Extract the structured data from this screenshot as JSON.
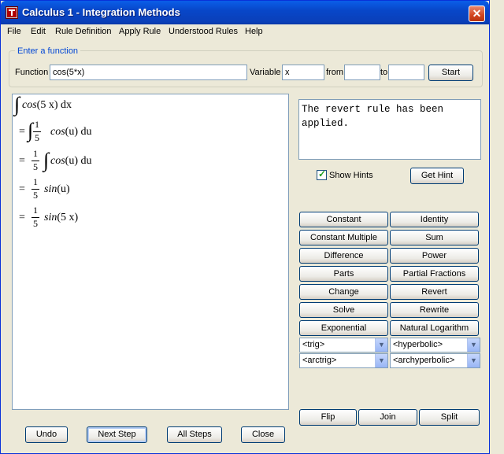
{
  "window": {
    "title": "Calculus 1 - Integration Methods",
    "close_glyph": "✕"
  },
  "menu": {
    "items": [
      "File",
      "Edit",
      "Rule Definition",
      "Apply Rule",
      "Understood Rules",
      "Help"
    ]
  },
  "entry": {
    "legend": "Enter a function",
    "function_label": "Function",
    "function_value": "cos(5*x)",
    "variable_label": "Variable",
    "variable_value": "x",
    "from_label": "from",
    "from_value": "",
    "to_label": "to",
    "to_value": "",
    "start_label": "Start"
  },
  "steps": {
    "line1": {
      "func": "cos",
      "arg": "(5 x)",
      "d": "dx"
    },
    "line2": {
      "eq": "=",
      "num": "1",
      "den": "5",
      "func": "cos",
      "arg": "(u)",
      "d": "du"
    },
    "line3": {
      "eq": "=",
      "num": "1",
      "den": "5",
      "func": "cos",
      "arg": "(u)",
      "d": "du"
    },
    "line4": {
      "eq": "=",
      "num": "1",
      "den": "5",
      "func": "sin",
      "arg": "(u)"
    },
    "line5": {
      "eq": "=",
      "num": "1",
      "den": "5",
      "func": "sin",
      "arg": "(5 x)"
    }
  },
  "hint": {
    "text": "The revert rule has been applied.",
    "show_hints_label": "Show Hints",
    "show_hints_checked": true,
    "get_hint_label": "Get Hint"
  },
  "rules": [
    "Constant",
    "Identity",
    "Constant Multiple",
    "Sum",
    "Difference",
    "Power",
    "Parts",
    "Partial Fractions",
    "Change",
    "Revert",
    "Solve",
    "Rewrite",
    "Exponential",
    "Natural Logarithm"
  ],
  "combos": [
    "<trig>",
    "<hyperbolic>",
    "<arctrig>",
    "<archyperbolic>"
  ],
  "tools": {
    "flip": "Flip",
    "join": "Join",
    "split": "Split"
  },
  "bottom": {
    "undo": "Undo",
    "next_step": "Next Step",
    "all_steps": "All Steps",
    "close": "Close"
  }
}
